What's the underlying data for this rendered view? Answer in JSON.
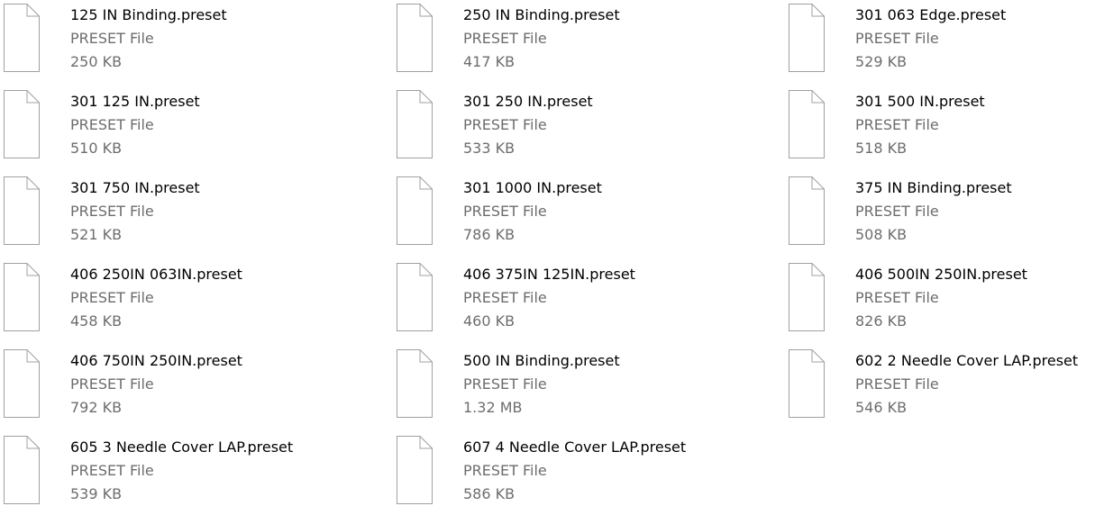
{
  "colors": {
    "name_text": "#000000",
    "detail_text": "#6d6d6d",
    "icon_outline": "#a0a0a0",
    "icon_fill": "#ffffff",
    "background": "#ffffff"
  },
  "files": [
    {
      "name": "125 IN Binding.preset",
      "type": "PRESET File",
      "size": "250 KB",
      "icon": "generic-file-icon"
    },
    {
      "name": "250 IN Binding.preset",
      "type": "PRESET File",
      "size": "417 KB",
      "icon": "generic-file-icon"
    },
    {
      "name": "301 063 Edge.preset",
      "type": "PRESET File",
      "size": "529 KB",
      "icon": "generic-file-icon"
    },
    {
      "name": "301 125 IN.preset",
      "type": "PRESET File",
      "size": "510 KB",
      "icon": "generic-file-icon"
    },
    {
      "name": "301 250 IN.preset",
      "type": "PRESET File",
      "size": "533 KB",
      "icon": "generic-file-icon"
    },
    {
      "name": "301 500 IN.preset",
      "type": "PRESET File",
      "size": "518 KB",
      "icon": "generic-file-icon"
    },
    {
      "name": "301 750 IN.preset",
      "type": "PRESET File",
      "size": "521 KB",
      "icon": "generic-file-icon"
    },
    {
      "name": "301 1000 IN.preset",
      "type": "PRESET File",
      "size": "786 KB",
      "icon": "generic-file-icon"
    },
    {
      "name": "375 IN Binding.preset",
      "type": "PRESET File",
      "size": "508 KB",
      "icon": "generic-file-icon"
    },
    {
      "name": "406 250IN 063IN.preset",
      "type": "PRESET File",
      "size": "458 KB",
      "icon": "generic-file-icon"
    },
    {
      "name": "406 375IN 125IN.preset",
      "type": "PRESET File",
      "size": "460 KB",
      "icon": "generic-file-icon"
    },
    {
      "name": "406 500IN 250IN.preset",
      "type": "PRESET File",
      "size": "826 KB",
      "icon": "generic-file-icon"
    },
    {
      "name": "406 750IN 250IN.preset",
      "type": "PRESET File",
      "size": "792 KB",
      "icon": "generic-file-icon"
    },
    {
      "name": "500 IN Binding.preset",
      "type": "PRESET File",
      "size": "1.32 MB",
      "icon": "generic-file-icon"
    },
    {
      "name": "602 2 Needle Cover LAP.preset",
      "type": "PRESET File",
      "size": "546 KB",
      "icon": "generic-file-icon"
    },
    {
      "name": "605 3 Needle Cover LAP.preset",
      "type": "PRESET File",
      "size": "539 KB",
      "icon": "generic-file-icon"
    },
    {
      "name": "607 4 Needle Cover LAP.preset",
      "type": "PRESET File",
      "size": "586 KB",
      "icon": "generic-file-icon"
    }
  ]
}
